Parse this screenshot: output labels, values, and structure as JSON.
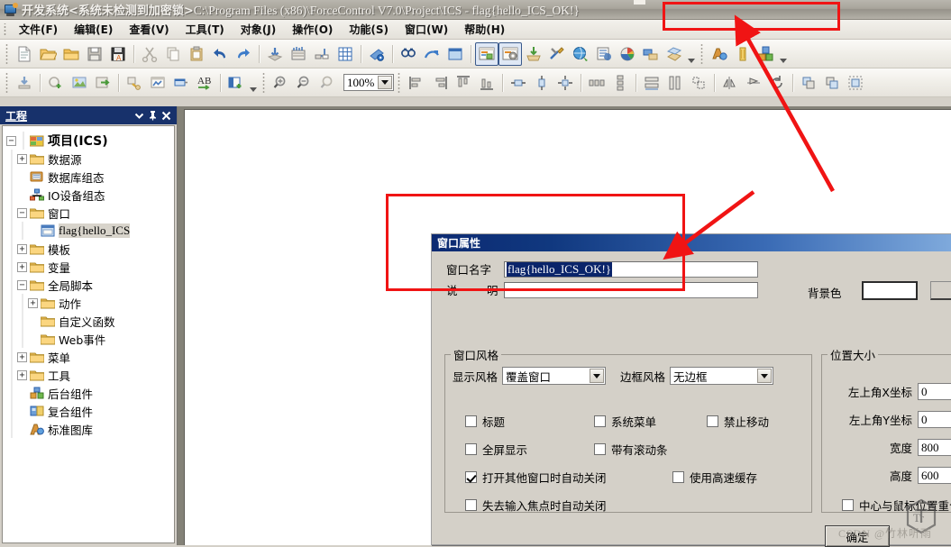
{
  "window": {
    "title_zh": "开发系统<系统未检测到加密锁>",
    "title_path": "C:\\Program Files (x86)\\ForceControl V7.0\\Project\\ICS",
    "title_sep": "-",
    "title_flag": "flag{hello_ICS_OK!}",
    "icon": "app-monitor-icon"
  },
  "menu": {
    "items": [
      {
        "label": "文件(F)",
        "name": "menu-file"
      },
      {
        "label": "编辑(E)",
        "name": "menu-edit"
      },
      {
        "label": "查看(V)",
        "name": "menu-view"
      },
      {
        "label": "工具(T)",
        "name": "menu-tools"
      },
      {
        "label": "对象(J)",
        "name": "menu-object"
      },
      {
        "label": "操作(O)",
        "name": "menu-operation"
      },
      {
        "label": "功能(S)",
        "name": "menu-function"
      },
      {
        "label": "窗口(W)",
        "name": "menu-window"
      },
      {
        "label": "帮助(H)",
        "name": "menu-help"
      }
    ]
  },
  "toolbar1": {
    "icons": [
      "new-file-icon",
      "open-folder-icon",
      "folder-icon",
      "save-icon",
      "save-as-icon",
      "cut-icon",
      "copy-icon",
      "paste-icon",
      "undo-icon",
      "redo-icon",
      "download-icon",
      "compile-icon",
      "connect-icon",
      "grid-icon",
      "run-icon",
      "find-icon",
      "navigate-icon",
      "window-icon",
      "window-config-icon",
      "window-settings-icon",
      "import-icon",
      "tools-icon",
      "web-icon",
      "print-config-icon",
      "palette-icon",
      "data-link-icon",
      "package-icon",
      "library-icon",
      "variable-icon",
      "components-icon"
    ]
  },
  "toolbar2": {
    "icons": [
      "insert-icon",
      "add-shape-icon",
      "image-icon",
      "export-icon",
      "link-icon",
      "chart-icon",
      "panel-icon",
      "text-ab-icon",
      "new-window-icon",
      "zoom-in-icon",
      "zoom-out-icon",
      "zoom-reset-icon"
    ],
    "zoom_value": "100%",
    "align_icons": [
      "align-left-icon",
      "align-right-icon",
      "align-top-icon",
      "align-bottom-icon",
      "center-h-icon",
      "center-v-icon",
      "center-both-icon",
      "distribute-h-icon",
      "distribute-v-icon",
      "same-width-icon",
      "same-height-icon",
      "same-size-icon",
      "flip-h-icon",
      "flip-v-icon",
      "rotate-icon",
      "bring-front-icon",
      "send-back-icon",
      "group-icon"
    ]
  },
  "panel": {
    "title": "工程",
    "header_icons": [
      "chevron-down-icon",
      "pin-icon",
      "close-icon"
    ],
    "tree": [
      {
        "label": "项目(ICS)",
        "depth": 0,
        "expander": "-",
        "icon": "project-icon",
        "bold": true
      },
      {
        "label": "数据源",
        "depth": 1,
        "expander": "+",
        "icon": "folder-icon"
      },
      {
        "label": "数据库组态",
        "depth": 1,
        "expander": "",
        "icon": "database-icon"
      },
      {
        "label": "IO设备组态",
        "depth": 1,
        "expander": "",
        "icon": "device-network-icon"
      },
      {
        "label": "窗口",
        "depth": 1,
        "expander": "-",
        "icon": "folder-icon"
      },
      {
        "label": "flag{hello_ICS",
        "depth": 2,
        "expander": "",
        "icon": "window-item-icon",
        "selected": true,
        "mono": true
      },
      {
        "label": "模板",
        "depth": 1,
        "expander": "+",
        "icon": "folder-icon"
      },
      {
        "label": "变量",
        "depth": 1,
        "expander": "+",
        "icon": "folder-icon"
      },
      {
        "label": "全局脚本",
        "depth": 1,
        "expander": "-",
        "icon": "folder-icon"
      },
      {
        "label": "动作",
        "depth": 2,
        "expander": "+",
        "icon": "folder-icon"
      },
      {
        "label": "自定义函数",
        "depth": 2,
        "expander": "",
        "icon": "folder-icon"
      },
      {
        "label": "Web事件",
        "depth": 2,
        "expander": "",
        "icon": "folder-icon"
      },
      {
        "label": "菜单",
        "depth": 1,
        "expander": "+",
        "icon": "folder-icon"
      },
      {
        "label": "工具",
        "depth": 1,
        "expander": "+",
        "icon": "folder-icon"
      },
      {
        "label": "后台组件",
        "depth": 1,
        "expander": "",
        "icon": "bg-component-icon"
      },
      {
        "label": "复合组件",
        "depth": 1,
        "expander": "",
        "icon": "composite-component-icon"
      },
      {
        "label": "标准图库",
        "depth": 1,
        "expander": "",
        "icon": "standard-gallery-icon"
      }
    ]
  },
  "dialog": {
    "title": "窗口属性",
    "name_label": "窗口名字",
    "name_value": "flag{hello_ICS_OK!}",
    "desc_label": "说　明",
    "desc_value": "",
    "bgcolor_label": "背景色",
    "bgcolor_value": "#ffffff",
    "style_group": {
      "legend": "窗口风格",
      "display_style_label": "显示风格",
      "display_style_value": "覆盖窗口",
      "border_style_label": "边框风格",
      "border_style_value": "无边框",
      "checkboxes": [
        {
          "label": "标题",
          "checked": false
        },
        {
          "label": "系统菜单",
          "checked": false
        },
        {
          "label": "禁止移动",
          "checked": false
        },
        {
          "label": "全屏显示",
          "checked": false
        },
        {
          "label": "带有滚动条",
          "checked": false
        },
        {
          "label": "打开其他窗口时自动关闭",
          "checked": true
        },
        {
          "label": "使用高速缓存",
          "checked": false
        },
        {
          "label": "失去输入焦点时自动关闭",
          "checked": false
        }
      ]
    },
    "pos_group": {
      "legend": "位置大小",
      "fields": [
        {
          "label": "左上角X坐标",
          "value": "0"
        },
        {
          "label": "左上角Y坐标",
          "value": "0"
        },
        {
          "label": "宽度",
          "value": "800"
        },
        {
          "label": "高度",
          "value": "600"
        }
      ],
      "center_mouse_label": "中心与鼠标位置重合",
      "center_mouse_checked": false
    },
    "ok_button": "确定"
  },
  "watermark": {
    "text": "CSDN @竹林听雨",
    "logo": "ctf-hexagon-logo"
  },
  "annotations": {
    "color": "#f01414",
    "boxes": [
      "title-flag-box",
      "dialog-name-box"
    ],
    "arrows": [
      "arrow-to-title",
      "arrow-to-dialog-title"
    ]
  }
}
